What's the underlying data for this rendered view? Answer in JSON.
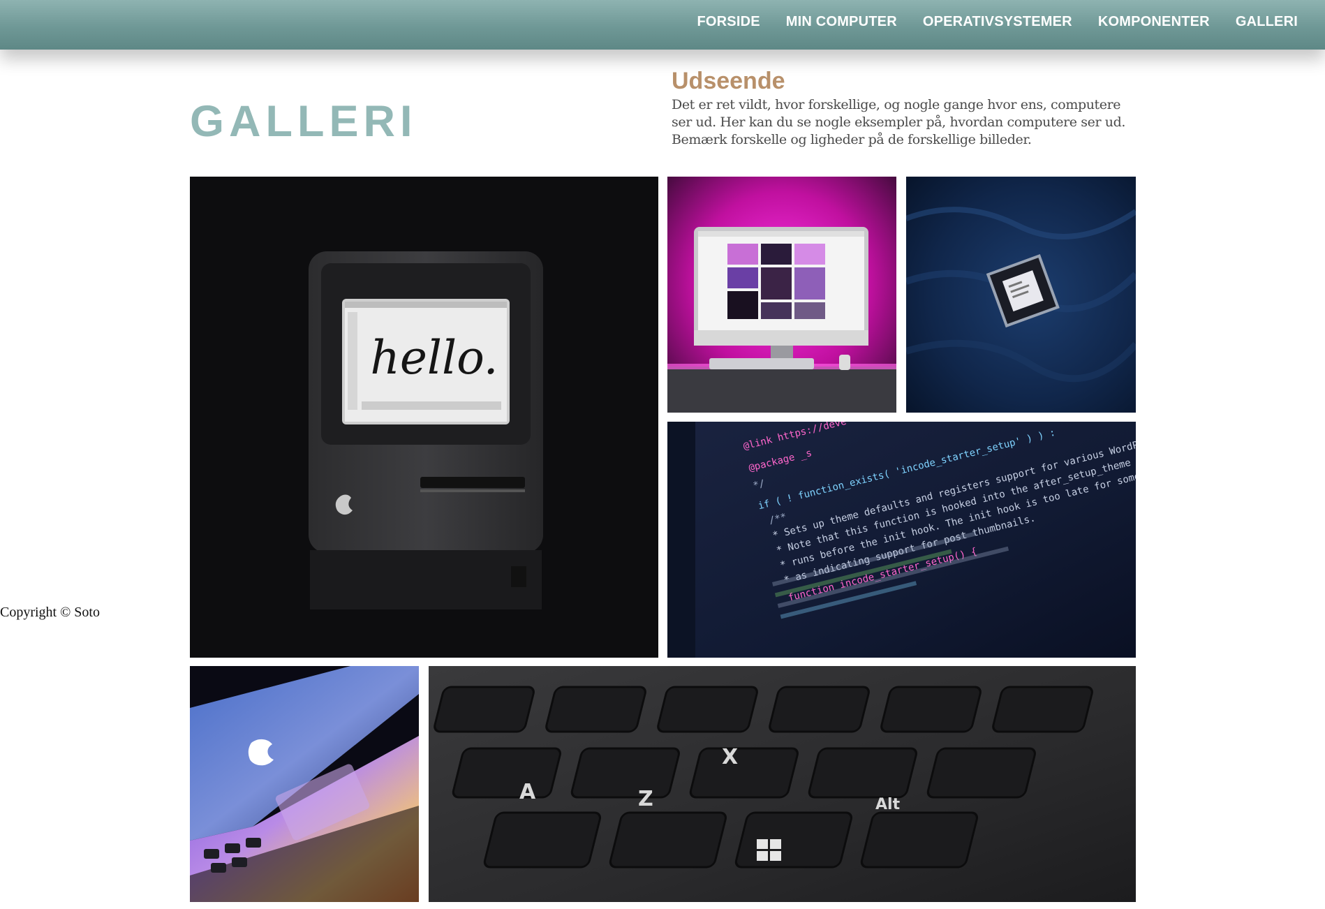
{
  "nav": {
    "items": [
      "FORSIDE",
      "MIN COMPUTER",
      "OPERATIVSYSTEMER",
      "KOMPONENTER",
      "GALLERI"
    ]
  },
  "page": {
    "title": "GALLERI"
  },
  "intro": {
    "heading": "Udseende",
    "text": "Det er ret vildt, hvor forskellige, og nogle gange hvor ens, computere ser ud. Her kan du se nogle eksempler på, hvordan computere ser ud. Bemærk forskelle og ligheder på de forskellige billeder."
  },
  "footer": {
    "copyright": "Copyright © Soto"
  },
  "gallery": {
    "mac_screen_text": "hello.",
    "code_lines": [
      "@link https://deve",
      "@package _s",
      "*/",
      "if ( ! function_exists( 'incode_starter_setup' ) ) :",
      "/**",
      " * Sets up theme defaults and registers support for various WordPress",
      " * Note that this function is hooked into the after_setup_theme hook",
      " * runs before the init hook. The init hook is too late for some",
      " * as indicating support for post thumbnails.",
      "function incode_starter_setup() {"
    ],
    "key_letters": [
      "A",
      "Z",
      "X",
      "Alt"
    ]
  },
  "colors": {
    "nav_bg": "#7aa3a1",
    "title": "#93b8b6",
    "heading": "#b8906a"
  }
}
